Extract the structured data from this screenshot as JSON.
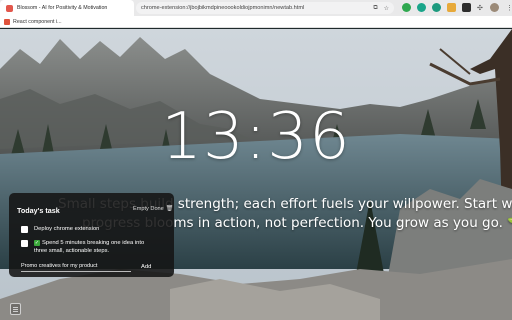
{
  "browser": {
    "tab_title": "Blossom - AI for Positivity & Motivation",
    "url": "chrome-extension://jbojbikmdpineoookoldiojpmonimn/newtab.html",
    "bookmark_label": "React component i..."
  },
  "clock": {
    "time": "13:36"
  },
  "quote": {
    "line1": "Small steps build strength; each effort fuels your willpower. Start with five minutes;",
    "line2": "progress blooms in action, not perfection. You grow as you go."
  },
  "task_panel": {
    "title": "Today's task",
    "empty_label": "Empty Done",
    "tasks": [
      {
        "text": "Deploy chrome extension",
        "checked": false
      },
      {
        "text": "Spend 5 minutes breaking one idea into three small, actionable steps.",
        "checked": false
      }
    ],
    "input_value": "Promo creatives for my product",
    "add_label": "Add"
  },
  "icons": [
    "favicon-icon",
    "translate-icon",
    "star-icon",
    "extension-icon",
    "puzzle-icon",
    "avatar",
    "menu-icon",
    "trash-icon",
    "sprout-icon",
    "checkmark-icon",
    "sidebar-icon"
  ]
}
